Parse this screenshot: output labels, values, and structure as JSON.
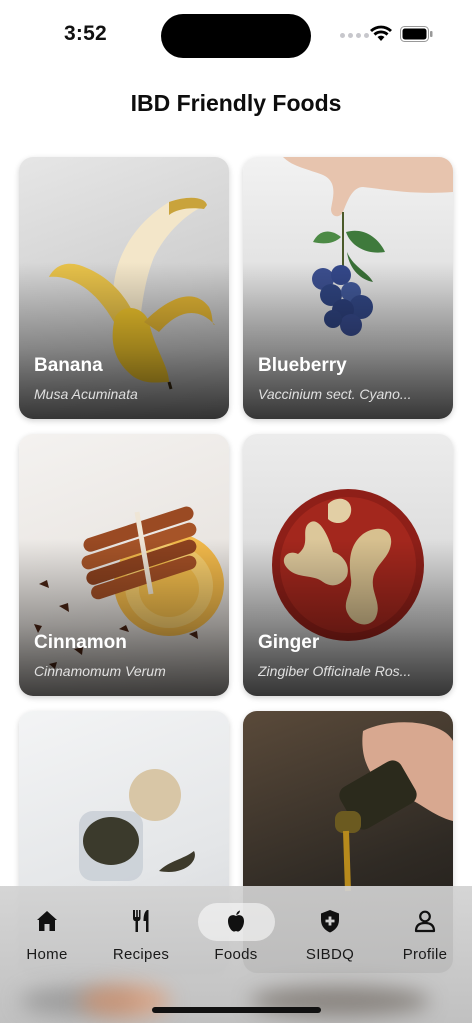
{
  "status_bar": {
    "time": "3:52"
  },
  "header": {
    "title": "IBD Friendly Foods"
  },
  "foods": [
    {
      "name": "Banana",
      "latin": "Musa Acuminata"
    },
    {
      "name": "Blueberry",
      "latin": "Vaccinium sect. Cyano..."
    },
    {
      "name": "Cinnamon",
      "latin": "Cinnamomum Verum"
    },
    {
      "name": "Ginger",
      "latin": "Zingiber Officinale Ros..."
    },
    {
      "name": "",
      "latin": ""
    },
    {
      "name": "",
      "latin": ""
    }
  ],
  "tabbar": {
    "active": "Foods",
    "tabs": [
      {
        "label": "Home",
        "icon": "home-icon"
      },
      {
        "label": "Recipes",
        "icon": "fork-knife-icon"
      },
      {
        "label": "Foods",
        "icon": "apple-icon"
      },
      {
        "label": "SIBDQ",
        "icon": "shield-plus-icon"
      },
      {
        "label": "Profile",
        "icon": "person-icon"
      }
    ]
  }
}
